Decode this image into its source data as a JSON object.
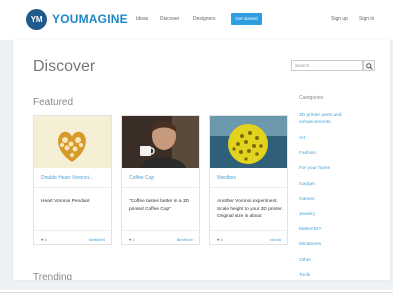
{
  "header": {
    "logo_mark": "YM",
    "brand": "YOUMAGINE",
    "nav": [
      "Ideas",
      "Discover",
      "Designers"
    ],
    "cta": "Get started",
    "sign_up": "Sign up",
    "sign_in": "Sign in"
  },
  "colors": {
    "brand_blue": "#1e88c7",
    "logo_circle": "#1f5a8a",
    "link_blue": "#4aa3d8",
    "cta_blue": "#2e9ee0"
  },
  "page": {
    "title": "Discover",
    "search_placeholder": "Search",
    "featured_heading": "Featured",
    "trending_heading": "Trending"
  },
  "cards": [
    {
      "title": "Double Heart Voronoi...",
      "desc": "Heart Voronoi Pendant",
      "likes": "4",
      "author": "Netfabb4",
      "image": "heart-pendant"
    },
    {
      "title": "Coffee Cup",
      "desc": "\"Coffee tastes better in a 3D printed Coffee Cup\"",
      "likes": "1",
      "author": "Benthore",
      "image": "man-with-cup"
    },
    {
      "title": "Nordbox",
      "desc": "Another Voronoi experiment. Scale height to your 3D printer. Original size is about",
      "likes": "4",
      "author": "robota",
      "image": "yellow-voronoi-sphere"
    }
  ],
  "categories": {
    "heading": "Categories",
    "items": [
      "3D printer parts and enhancements",
      "Art",
      "Fashion",
      "For your home",
      "Gadget",
      "Games",
      "Jewelry",
      "Maker/DIY",
      "Miniatures",
      "Other",
      "Tools"
    ]
  }
}
